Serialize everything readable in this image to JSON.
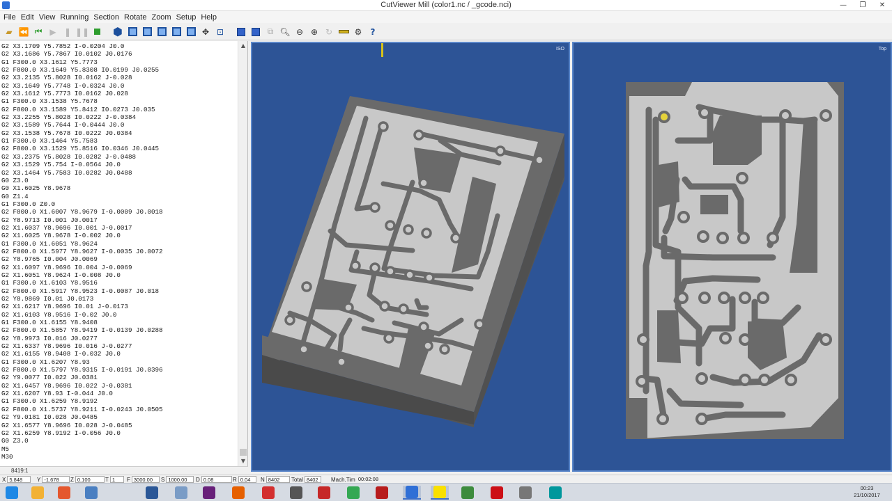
{
  "window": {
    "title": "CutViewer Mill (color1.nc / _gcode.nci)",
    "minimize_glyph": "—",
    "maximize_glyph": "❐",
    "close_glyph": "✕"
  },
  "menu": [
    "File",
    "Edit",
    "View",
    "Running",
    "Section",
    "Rotate",
    "Zoom",
    "Setup",
    "Help"
  ],
  "toolbar": {
    "icons": [
      "open-file-icon",
      "rewind-icon",
      "step-icon",
      "play-icon",
      "pause-icon",
      "stop-icon",
      "iso-view-icon",
      "front-view-icon",
      "right-view-icon",
      "top-view-icon",
      "left-view-icon",
      "back-view-icon",
      "pan-icon",
      "zoom-window-icon",
      "section-icon",
      "solid-icon",
      "wire-icon",
      "zoom-in-icon",
      "zoom-out-icon",
      "zoom-fit-icon",
      "rotate-icon",
      "ruler-icon",
      "tool-icon",
      "help-icon"
    ]
  },
  "code": {
    "lines": [
      "G2 X3.1709 Y5.7852 I-0.0204 J0.0",
      "G2 X3.1686 Y5.7867 I0.0102 J0.0176",
      "G1 F300.0 X3.1612 Y5.7773",
      "G2 F800.0 X3.1649 Y5.8308 I0.0199 J0.0255",
      "G2 X3.2135 Y5.8028 I0.0162 J-0.028",
      "G2 X3.1649 Y5.7748 I-0.0324 J0.0",
      "G2 X3.1612 Y5.7773 I0.0162 J0.028",
      "G1 F300.0 X3.1538 Y5.7678",
      "G2 F800.0 X3.1589 Y5.8412 I0.0273 J0.035",
      "G2 X3.2255 Y5.8028 I0.0222 J-0.0384",
      "G2 X3.1589 Y5.7644 I-0.0444 J0.0",
      "G2 X3.1538 Y5.7678 I0.0222 J0.0384",
      "G1 F300.0 X3.1464 Y5.7583",
      "G2 F800.0 X3.1529 Y5.8516 I0.0346 J0.0445",
      "G2 X3.2375 Y5.8028 I0.0282 J-0.0488",
      "G2 X3.1529 Y5.754 I-0.0564 J0.0",
      "G2 X3.1464 Y5.7583 I0.0282 J0.0488",
      "G0 Z3.0",
      "G0 X1.6025 Y8.9678",
      "G0 Z1.4",
      "G1 F300.0 Z0.0",
      "G2 F800.0 X1.6007 Y8.9679 I-0.0009 J0.0018",
      "G2 Y8.9713 I0.001 J0.0017",
      "G2 X1.6037 Y8.9696 I0.001 J-0.0017",
      "G2 X1.6025 Y8.9678 I-0.002 J0.0",
      "G1 F300.0 X1.6051 Y8.9624",
      "G2 F800.0 X1.5977 Y8.9627 I-0.0035 J0.0072",
      "G2 Y8.9765 I0.004 J0.0069",
      "G2 X1.6097 Y8.9696 I0.004 J-0.0069",
      "G2 X1.6051 Y8.9624 I-0.008 J0.0",
      "G1 F300.0 X1.6103 Y8.9516",
      "G2 F800.0 X1.5917 Y8.9523 I-0.0087 J0.018",
      "G2 Y8.9869 I0.01 J0.0173",
      "G2 X1.6217 Y8.9696 I0.01 J-0.0173",
      "G2 X1.6103 Y8.9516 I-0.02 J0.0",
      "G1 F300.0 X1.6155 Y8.9408",
      "G2 F800.0 X1.5857 Y8.9419 I-0.0139 J0.0288",
      "G2 Y8.9973 I0.016 J0.0277",
      "G2 X1.6337 Y8.9696 I0.016 J-0.0277",
      "G2 X1.6155 Y8.9408 I-0.032 J0.0",
      "G1 F300.0 X1.6207 Y8.93",
      "G2 F800.0 X1.5797 Y8.9315 I-0.0191 J0.0396",
      "G2 Y9.0077 I0.022 J0.0381",
      "G2 X1.6457 Y8.9696 I0.022 J-0.0381",
      "G2 X1.6207 Y8.93 I-0.044 J0.0",
      "G1 F300.0 X1.6259 Y8.9192",
      "G2 F800.0 X1.5737 Y8.9211 I-0.0243 J0.0505",
      "G2 Y9.0181 I0.028 J0.0485",
      "G2 X1.6577 Y8.9696 I0.028 J-0.0485",
      "G2 X1.6259 Y8.9192 I-0.056 J0.0",
      "G0 Z3.0",
      "M5",
      "M30"
    ],
    "line_counter": "8419:1"
  },
  "viewports": {
    "iso_label": "ISO",
    "top_label": "Top"
  },
  "status": {
    "x_label": "X",
    "x_value": "5.848",
    "y_label": "Y",
    "y_value": "-1.678",
    "z_label": "Z",
    "z_value": "0.100",
    "t_label": "T",
    "t_value": "1",
    "f_label": "F",
    "f_value": "3000.00",
    "s_label": "S",
    "s_value": "1000.00",
    "d_label": "D",
    "d_value": "0.08",
    "r_label": "R",
    "r_value": "0.04",
    "n_label": "N",
    "n_value": "8402",
    "total_label": "Total",
    "total_value": "8402",
    "mach_label": "Mach.Tim",
    "mach_value": "00:02:08"
  },
  "taskbar": {
    "apps": [
      {
        "name": "start-icon",
        "color": "#1e88e5"
      },
      {
        "name": "explorer-icon",
        "color": "#f2b134"
      },
      {
        "name": "paint-icon",
        "color": "#e4572e"
      },
      {
        "name": "app-icon",
        "color": "#4a7fc1"
      },
      {
        "name": "word-icon",
        "color": "#2b5797"
      },
      {
        "name": "notepad-icon",
        "color": "#7a9cc6"
      },
      {
        "name": "visual-studio-icon",
        "color": "#68217a"
      },
      {
        "name": "firefox-icon",
        "color": "#e66000"
      },
      {
        "name": "app2-icon",
        "color": "#d32f2f"
      },
      {
        "name": "app3-icon",
        "color": "#555555"
      },
      {
        "name": "app4-icon",
        "color": "#c62828"
      },
      {
        "name": "chrome-icon",
        "color": "#34a853"
      },
      {
        "name": "app5-icon",
        "color": "#b71c1c"
      },
      {
        "name": "cutviewer-icon",
        "color": "#2f6fd6"
      },
      {
        "name": "app6-icon",
        "color": "#f9e000"
      },
      {
        "name": "app7-icon",
        "color": "#3d8b3d"
      },
      {
        "name": "opera-icon",
        "color": "#cc0f16"
      },
      {
        "name": "app8-icon",
        "color": "#777777"
      },
      {
        "name": "arduino-icon",
        "color": "#00979c"
      }
    ],
    "time": "00:23",
    "date": "21/10/2017"
  },
  "colors": {
    "viewport_bg": "#2d5496",
    "board_light": "#c8c8c8",
    "board_dark": "#6a6a6a",
    "board_side": "#555555",
    "tool_marker": "#d6c21a"
  }
}
